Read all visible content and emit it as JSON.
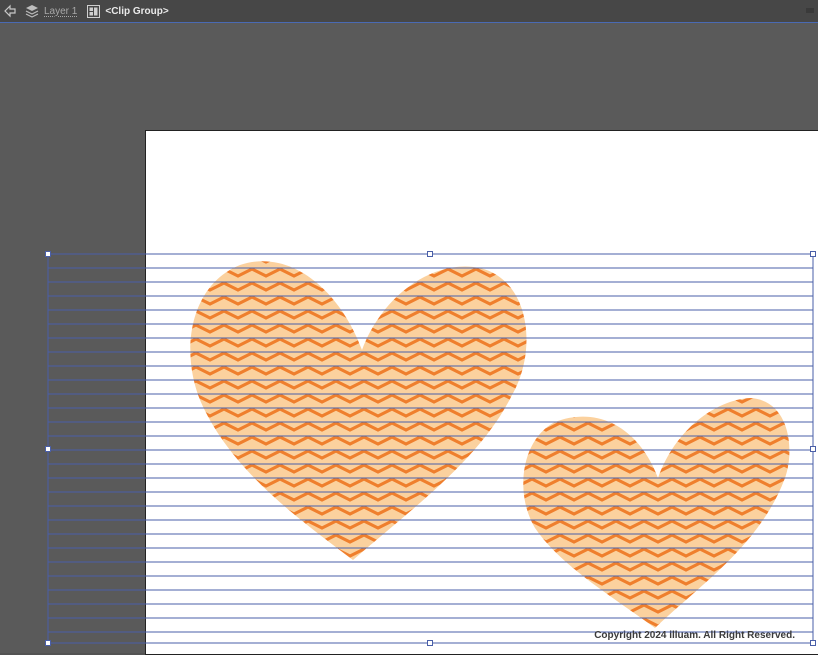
{
  "breadcrumb": {
    "layer_label": "Layer 1",
    "group_label": "<Clip Group>"
  },
  "icons": {
    "back": "back-arrow-icon",
    "layers": "layers-icon",
    "clip_group": "clip-group-icon"
  },
  "colors": {
    "workspace": "#535353",
    "toolbar": "#474747",
    "selection": "#4a6ab3",
    "heart_light": "#fbd19e",
    "heart_stripe": "#ef7f2d"
  },
  "artwork": {
    "copyright": "Copyright 2024 illuam. All Right Reserved."
  }
}
